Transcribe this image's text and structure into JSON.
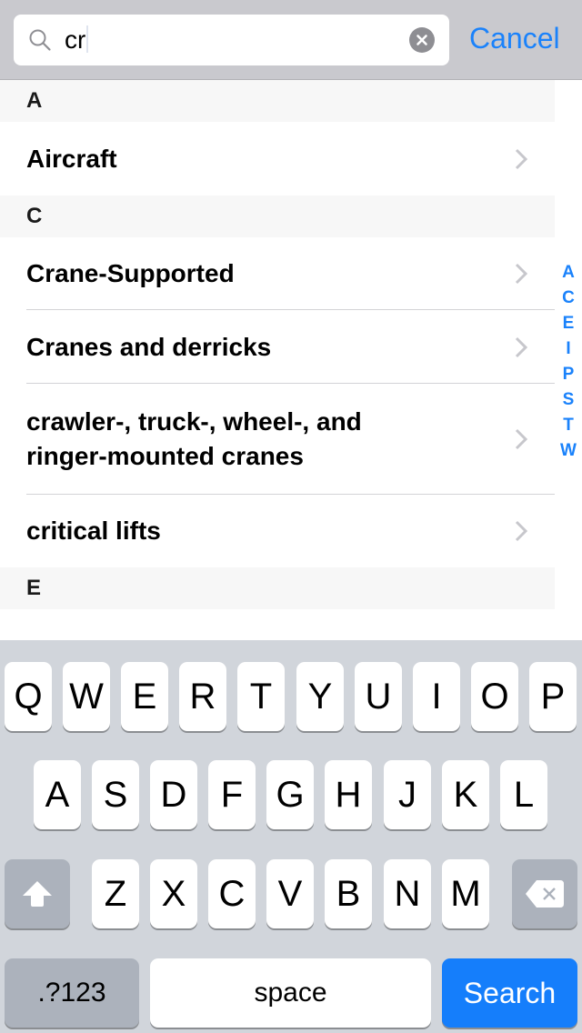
{
  "search": {
    "query": "cr",
    "cancel_label": "Cancel",
    "search_icon": "magnifier-icon",
    "clear_icon": "clear-x-icon"
  },
  "colors": {
    "accent": "#1a82fb",
    "search_key": "#157efb",
    "keyboard_bg": "#d1d5db",
    "section_bg": "#f7f7f7"
  },
  "list": {
    "sections": [
      {
        "header": "A",
        "items": [
          {
            "label": "Aircraft"
          }
        ]
      },
      {
        "header": "C",
        "items": [
          {
            "label": "Crane-Supported"
          },
          {
            "label": "Cranes and derricks"
          },
          {
            "label": "crawler-, truck-, wheel-, and ringer-mounted cranes"
          },
          {
            "label": "critical lifts"
          }
        ]
      },
      {
        "header": "E",
        "items": []
      }
    ]
  },
  "index": [
    "A",
    "C",
    "E",
    "I",
    "P",
    "S",
    "T",
    "W"
  ],
  "keyboard": {
    "row1": [
      "Q",
      "W",
      "E",
      "R",
      "T",
      "Y",
      "U",
      "I",
      "O",
      "P"
    ],
    "row2": [
      "A",
      "S",
      "D",
      "F",
      "G",
      "H",
      "J",
      "K",
      "L"
    ],
    "row3": [
      "Z",
      "X",
      "C",
      "V",
      "B",
      "N",
      "M"
    ],
    "shift_icon": "shift-arrow-icon",
    "delete_icon": "backspace-icon",
    "numbers_label": ".?123",
    "space_label": "space",
    "search_label": "Search"
  }
}
